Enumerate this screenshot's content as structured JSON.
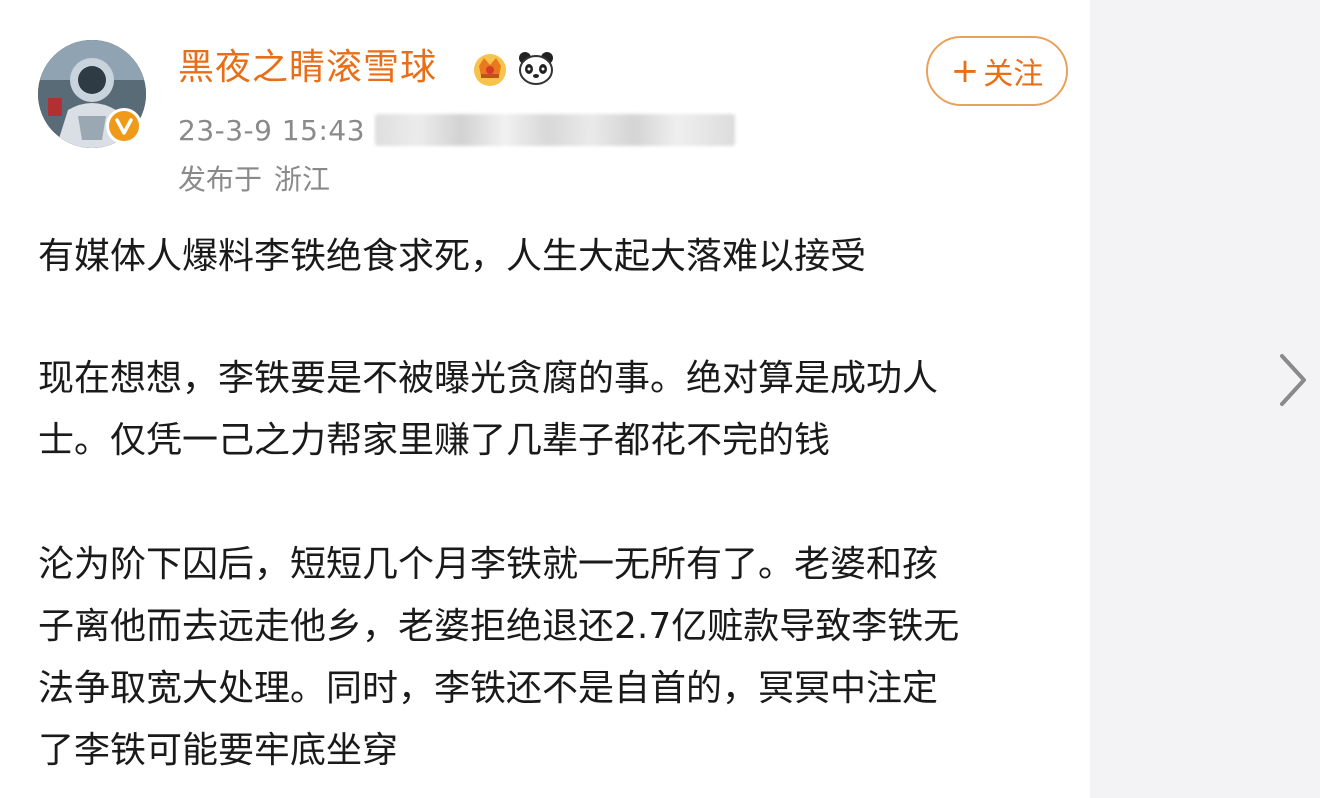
{
  "post": {
    "author": {
      "name": "黑夜之睛滚雪球",
      "avatar": "avatar",
      "verified_icon": "verified-v-icon",
      "badges": [
        "crown-badge-icon",
        "panda-badge-icon"
      ]
    },
    "timestamp": "23-3-9 15:43",
    "location_prefix": "发布于",
    "location": "浙江",
    "follow_button": {
      "plus": "+",
      "label": "关注"
    },
    "paragraphs": [
      [
        "有媒体人爆料李铁绝食求死，人生大起大落难以接受"
      ],
      [
        "现在想想，李铁要是不被曝光贪腐的事。绝对算是成功人",
        "士。仅凭一己之力帮家里赚了几辈子都花不完的钱"
      ],
      [
        "沦为阶下囚后，短短几个月李铁就一无所有了。老婆和孩",
        "子离他而去远走他乡，老婆拒绝退还2.7亿赃款导致李铁无",
        "法争取宽大处理。同时，李铁还不是自首的，冥冥中注定",
        "了李铁可能要牢底坐穿"
      ]
    ]
  },
  "colors": {
    "username": "#e86f17",
    "meta_text": "#8a8a8a",
    "follow_border": "#e8a25a",
    "verified_badge": "#f09a1a",
    "body_text": "#1a1a1a"
  },
  "navigation": {
    "next_icon": "chevron-right-icon"
  }
}
